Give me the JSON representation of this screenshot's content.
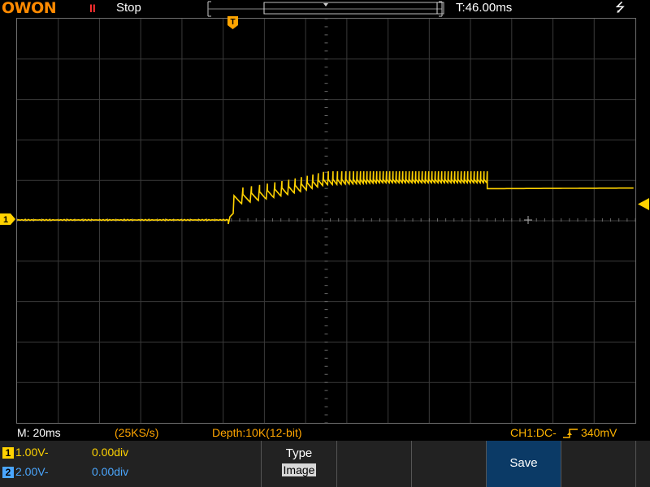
{
  "header": {
    "logo": "OWON",
    "run_icon": "II",
    "run_state": "Stop",
    "trigger_time": "T:46.00ms",
    "usb_icon": "usb-icon",
    "trigger_marker": "T"
  },
  "status_line": {
    "timebase": "M: 20ms",
    "sample_rate": "(25KS/s)",
    "depth": "Depth:10K(12-bit)",
    "trigger_info": "CH1:DC-",
    "trigger_edge": "rising-edge-icon",
    "trigger_level": "340mV"
  },
  "channels": [
    {
      "id": "1",
      "scale": "1.00V-",
      "offset": "0.00div",
      "color": "#ffd200"
    },
    {
      "id": "2",
      "scale": "2.00V-",
      "offset": "0.00div",
      "color": "#4aa6ff"
    }
  ],
  "menu": {
    "type_title": "Type",
    "type_value": "Image",
    "save_label": "Save"
  },
  "colors": {
    "trace": "#ffd200",
    "logo": "#ff8a00",
    "panel_bg": "#222222",
    "save_bg": "#0b3a66"
  },
  "markers": {
    "ch1_marker": "1"
  }
}
